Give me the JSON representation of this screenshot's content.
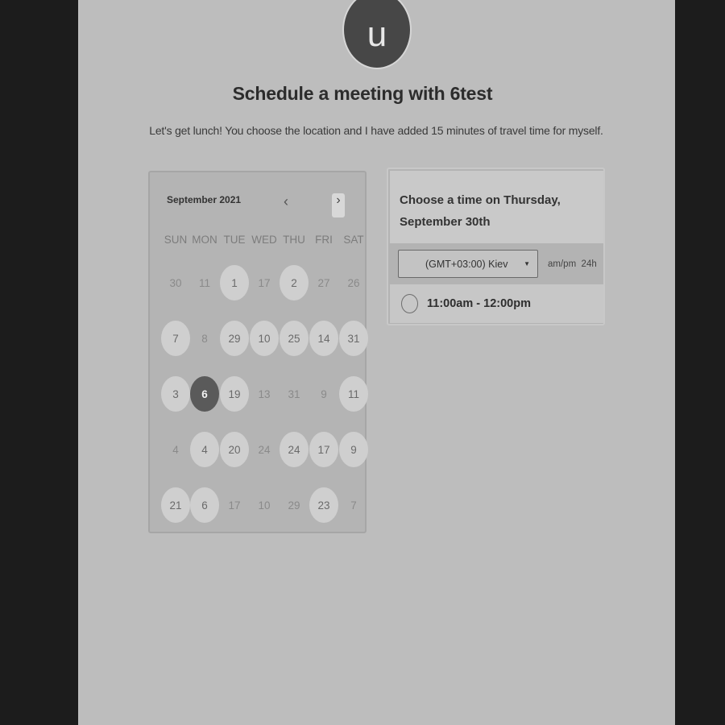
{
  "header": {
    "avatar_initial": "u",
    "title": "Schedule a meeting with 6test",
    "description": "Let's get lunch! You choose the location and I have added 15 minutes of travel time for myself."
  },
  "calendar": {
    "month_label": "September 2021",
    "prev_icon": "‹",
    "next_icon": "›",
    "weekdays": [
      "SUN",
      "MON",
      "TUE",
      "WED",
      "THU",
      "FRI",
      "SAT"
    ],
    "weeks": [
      [
        {
          "d": "30",
          "s": "off"
        },
        {
          "d": "11",
          "s": "off"
        },
        {
          "d": "1",
          "s": "avail"
        },
        {
          "d": "17",
          "s": "off"
        },
        {
          "d": "2",
          "s": "avail"
        },
        {
          "d": "27",
          "s": "off"
        },
        {
          "d": "26",
          "s": "off"
        }
      ],
      [
        {
          "d": "7",
          "s": "avail"
        },
        {
          "d": "8",
          "s": "off"
        },
        {
          "d": "29",
          "s": "avail"
        },
        {
          "d": "10",
          "s": "avail"
        },
        {
          "d": "25",
          "s": "avail"
        },
        {
          "d": "14",
          "s": "avail"
        },
        {
          "d": "31",
          "s": "avail"
        }
      ],
      [
        {
          "d": "3",
          "s": "avail"
        },
        {
          "d": "6",
          "s": "selected"
        },
        {
          "d": "19",
          "s": "avail"
        },
        {
          "d": "13",
          "s": "off"
        },
        {
          "d": "31",
          "s": "off"
        },
        {
          "d": "9",
          "s": "off"
        },
        {
          "d": "11",
          "s": "avail"
        }
      ],
      [
        {
          "d": "4",
          "s": "off"
        },
        {
          "d": "4",
          "s": "avail"
        },
        {
          "d": "20",
          "s": "avail"
        },
        {
          "d": "24",
          "s": "off"
        },
        {
          "d": "24",
          "s": "avail"
        },
        {
          "d": "17",
          "s": "avail"
        },
        {
          "d": "9",
          "s": "avail"
        }
      ],
      [
        {
          "d": "21",
          "s": "avail"
        },
        {
          "d": "6",
          "s": "avail"
        },
        {
          "d": "17",
          "s": "off"
        },
        {
          "d": "10",
          "s": "off"
        },
        {
          "d": "29",
          "s": "off"
        },
        {
          "d": "23",
          "s": "avail"
        },
        {
          "d": "7",
          "s": "off"
        }
      ]
    ]
  },
  "times": {
    "heading": "Choose a time on Thursday, September 30th",
    "timezone": "(GMT+03:00) Kiev",
    "format_12h": "am/pm",
    "format_24h": "24h",
    "slots": [
      "11:00am - 12:00pm"
    ]
  }
}
